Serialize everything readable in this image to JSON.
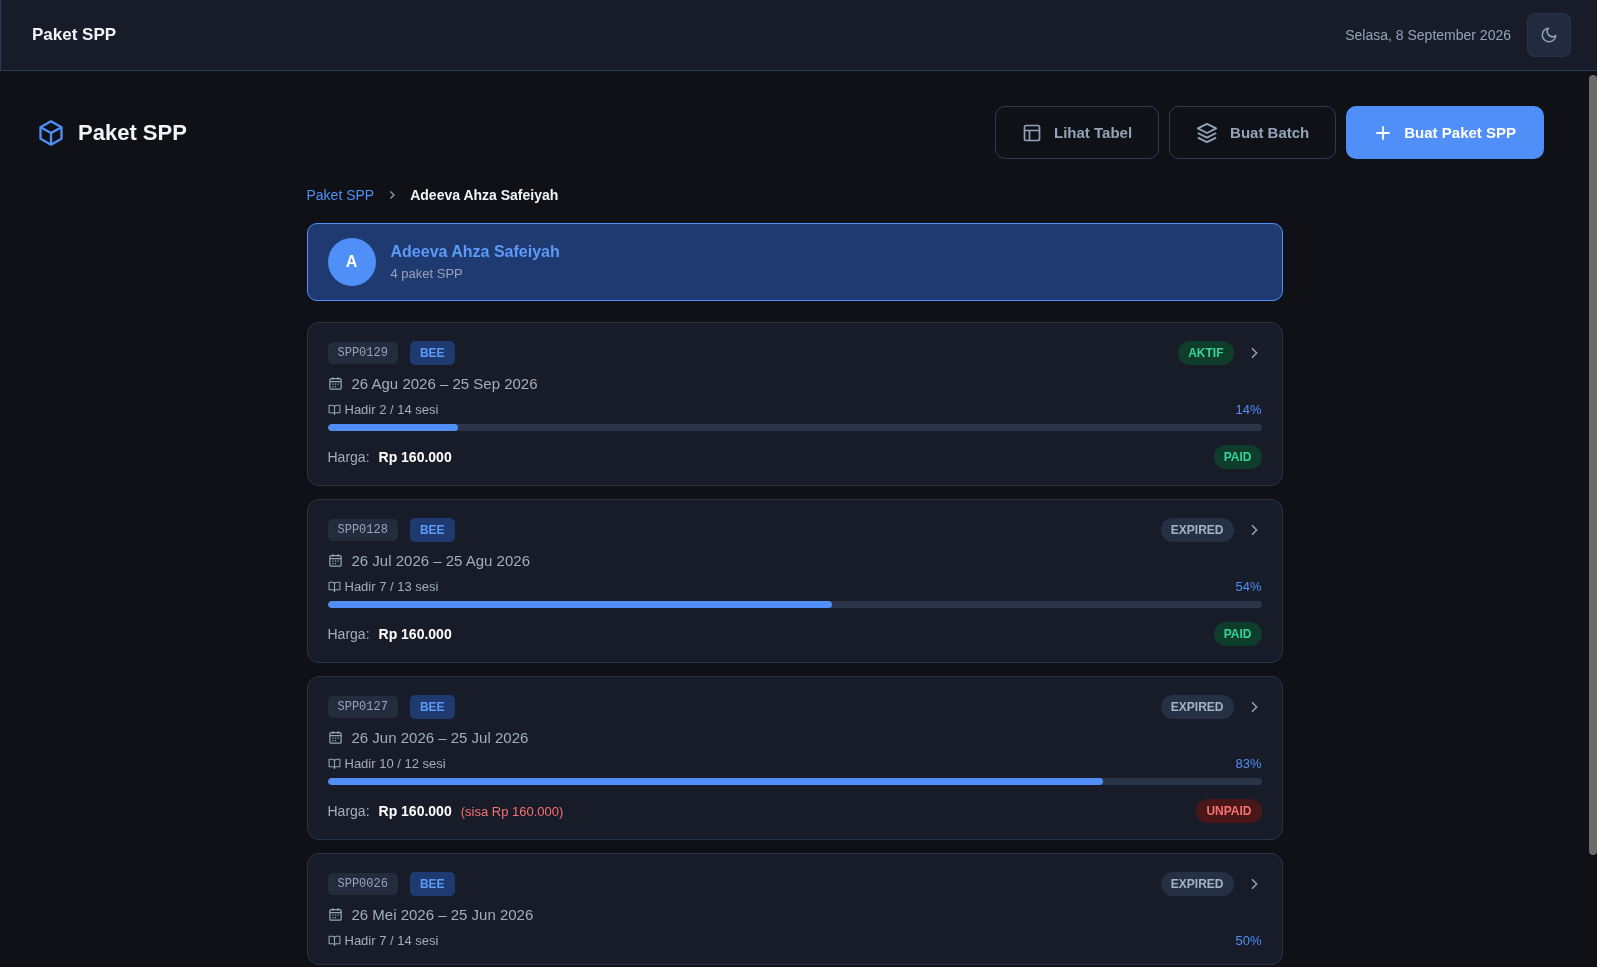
{
  "topbar": {
    "title": "Paket SPP",
    "date": "Selasa, 8 September 2026"
  },
  "page": {
    "title": "Paket SPP",
    "buttons": [
      {
        "label": "Lihat Tabel",
        "kind": "table"
      },
      {
        "label": "Buat Batch",
        "kind": "batch"
      },
      {
        "label": "Buat Paket SPP",
        "kind": "create"
      }
    ]
  },
  "breadcrumb": {
    "parent": "Paket SPP",
    "current": "Adeeva Ahza Safeiyah"
  },
  "student": {
    "initial": "A",
    "name": "Adeeva Ahza Safeiyah",
    "count": "4 paket SPP"
  },
  "packages": [
    {
      "code": "SPP0129",
      "program": "BEE",
      "status": {
        "label": "AKTIF",
        "kind": "active"
      },
      "period": "26 Agu 2026 – 25 Sep 2026",
      "attendance": "Hadir 2 / 14 sesi",
      "percent": "14%",
      "level": 0.14,
      "price_label": "Harga:",
      "price": "Rp 160.000",
      "payment": {
        "label": "PAID",
        "kind": "paid"
      }
    },
    {
      "code": "SPP0128",
      "program": "BEE",
      "status": {
        "label": "EXPIRED",
        "kind": "expired"
      },
      "period": "26 Jul 2026 – 25 Agu 2026",
      "attendance": "Hadir 7 / 13 sesi",
      "percent": "54%",
      "level": 0.54,
      "price_label": "Harga:",
      "price": "Rp 160.000",
      "payment": {
        "label": "PAID",
        "kind": "paid"
      }
    },
    {
      "code": "SPP0127",
      "program": "BEE",
      "status": {
        "label": "EXPIRED",
        "kind": "expired"
      },
      "period": "26 Jun 2026 – 25 Jul 2026",
      "attendance": "Hadir 10 / 12 sesi",
      "percent": "83%",
      "level": 0.83,
      "price_label": "Harga:",
      "price": "Rp 160.000",
      "remaining": "(sisa Rp 160.000)",
      "payment": {
        "label": "UNPAID",
        "kind": "unpaid"
      }
    },
    {
      "code": "SPP0026",
      "program": "BEE",
      "status": {
        "label": "EXPIRED",
        "kind": "expired"
      },
      "period": "26 Mei 2026 – 25 Jun 2026",
      "attendance": "Hadir 7 / 14 sesi",
      "percent": "50%"
    }
  ]
}
